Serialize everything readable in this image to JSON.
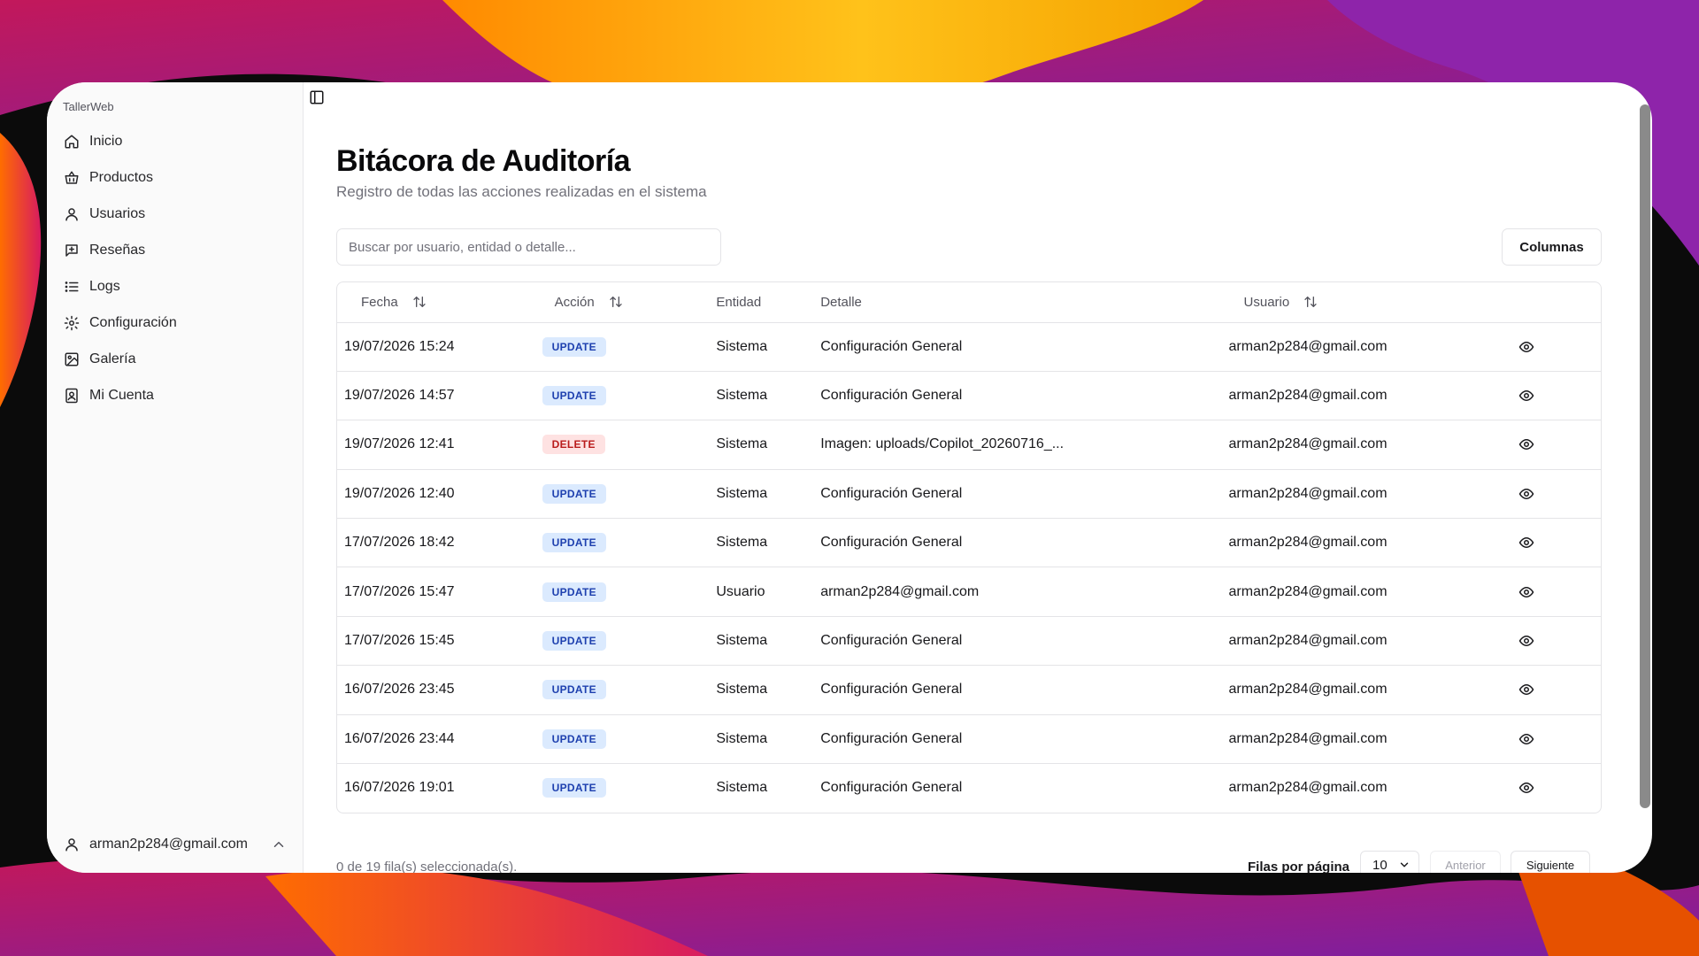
{
  "app": {
    "brand": "TallerWeb"
  },
  "sidebar": {
    "items": [
      {
        "label": "Inicio",
        "icon": "home-icon"
      },
      {
        "label": "Productos",
        "icon": "basket-icon"
      },
      {
        "label": "Usuarios",
        "icon": "user-icon"
      },
      {
        "label": "Reseñas",
        "icon": "message-plus-icon"
      },
      {
        "label": "Logs",
        "icon": "list-icon"
      },
      {
        "label": "Configuración",
        "icon": "gear-icon"
      },
      {
        "label": "Galería",
        "icon": "image-icon"
      },
      {
        "label": "Mi Cuenta",
        "icon": "contact-icon"
      }
    ],
    "account_email": "arman2p284@gmail.com"
  },
  "page": {
    "title": "Bitácora de Auditoría",
    "subtitle": "Registro de todas las acciones realizadas en el sistema",
    "search_placeholder": "Buscar por usuario, entidad o detalle...",
    "columns_button": "Columnas"
  },
  "table": {
    "headers": {
      "fecha": "Fecha",
      "accion": "Acción",
      "entidad": "Entidad",
      "detalle": "Detalle",
      "usuario": "Usuario"
    },
    "rows": [
      {
        "fecha": "19/07/2026 15:24",
        "accion": "UPDATE",
        "entidad": "Sistema",
        "detalle": "Configuración General",
        "usuario": "arman2p284@gmail.com"
      },
      {
        "fecha": "19/07/2026 14:57",
        "accion": "UPDATE",
        "entidad": "Sistema",
        "detalle": "Configuración General",
        "usuario": "arman2p284@gmail.com"
      },
      {
        "fecha": "19/07/2026 12:41",
        "accion": "DELETE",
        "entidad": "Sistema",
        "detalle": "Imagen: uploads/Copilot_20260716_...",
        "usuario": "arman2p284@gmail.com"
      },
      {
        "fecha": "19/07/2026 12:40",
        "accion": "UPDATE",
        "entidad": "Sistema",
        "detalle": "Configuración General",
        "usuario": "arman2p284@gmail.com"
      },
      {
        "fecha": "17/07/2026 18:42",
        "accion": "UPDATE",
        "entidad": "Sistema",
        "detalle": "Configuración General",
        "usuario": "arman2p284@gmail.com"
      },
      {
        "fecha": "17/07/2026 15:47",
        "accion": "UPDATE",
        "entidad": "Usuario",
        "detalle": "arman2p284@gmail.com",
        "usuario": "arman2p284@gmail.com"
      },
      {
        "fecha": "17/07/2026 15:45",
        "accion": "UPDATE",
        "entidad": "Sistema",
        "detalle": "Configuración General",
        "usuario": "arman2p284@gmail.com"
      },
      {
        "fecha": "16/07/2026 23:45",
        "accion": "UPDATE",
        "entidad": "Sistema",
        "detalle": "Configuración General",
        "usuario": "arman2p284@gmail.com"
      },
      {
        "fecha": "16/07/2026 23:44",
        "accion": "UPDATE",
        "entidad": "Sistema",
        "detalle": "Configuración General",
        "usuario": "arman2p284@gmail.com"
      },
      {
        "fecha": "16/07/2026 19:01",
        "accion": "UPDATE",
        "entidad": "Sistema",
        "detalle": "Configuración General",
        "usuario": "arman2p284@gmail.com"
      }
    ]
  },
  "pagination": {
    "selected_text": "0 de 19 fila(s) seleccionada(s).",
    "rows_per_page_label": "Filas por página",
    "rows_per_page_value": "10",
    "prev": "Anterior",
    "next": "Siguiente"
  },
  "colors": {
    "update_badge_bg": "#dbeafe",
    "update_badge_text": "#1e40af",
    "delete_badge_bg": "#fee2e2",
    "delete_badge_text": "#b91c1c"
  }
}
